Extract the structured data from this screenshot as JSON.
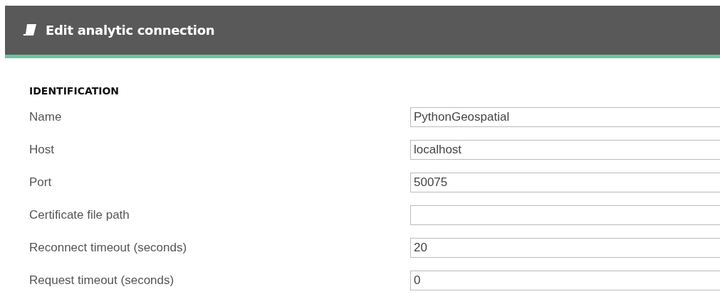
{
  "window": {
    "title": "Edit analytic connection"
  },
  "section": {
    "title": "IDENTIFICATION"
  },
  "fields": [
    {
      "label": "Name",
      "value": "PythonGeospatial"
    },
    {
      "label": "Host",
      "value": "localhost"
    },
    {
      "label": "Port",
      "value": "50075"
    },
    {
      "label": "Certificate file path"
    },
    {
      "label": "Reconnect timeout (seconds)",
      "value": "20"
    },
    {
      "label": "Request timeout (seconds)",
      "value": "0"
    }
  ]
}
